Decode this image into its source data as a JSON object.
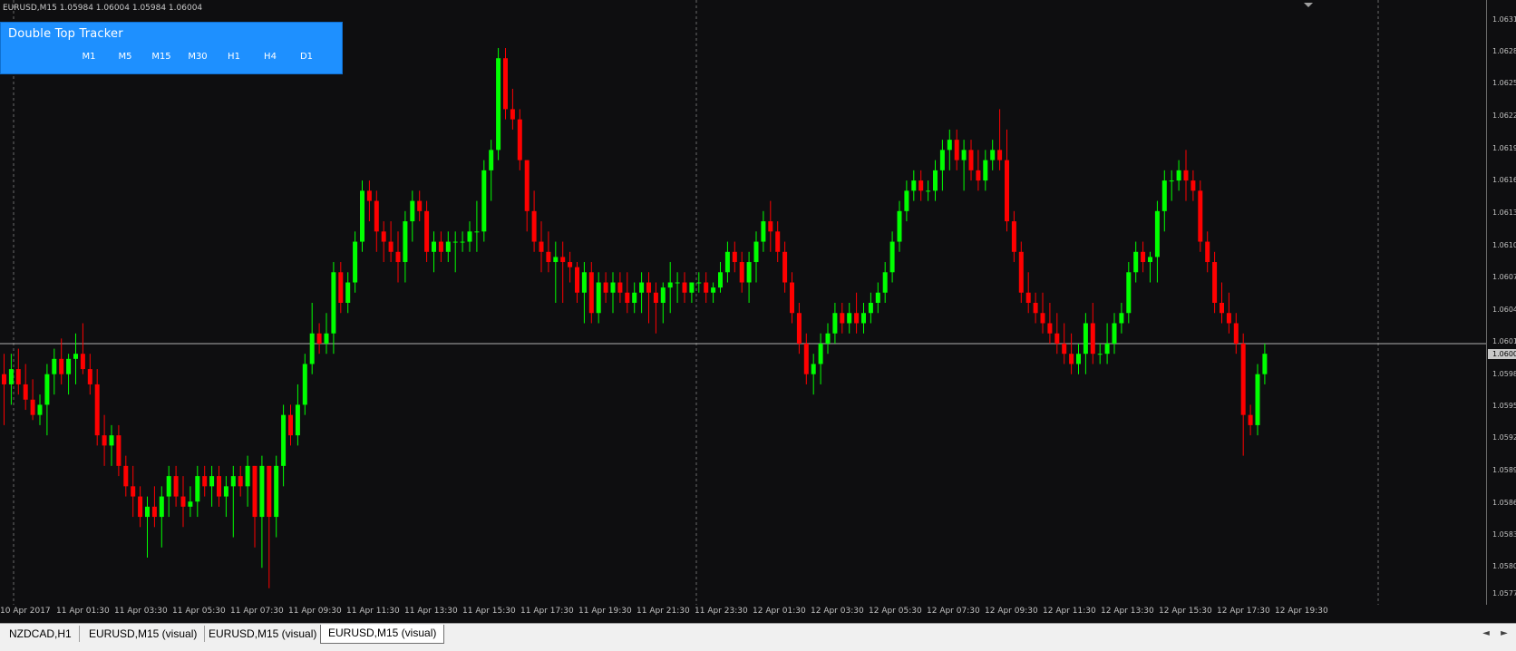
{
  "chart": {
    "symbol_info": "EURUSD,M15  1.05984 1.06004 1.05984 1.06004",
    "current_price": "1.0600",
    "bull_color": "#00ff00",
    "bear_color": "#ff0000",
    "background": "#0e0e10"
  },
  "tracker": {
    "title": "Double Top Tracker",
    "timeframes": [
      "M1",
      "M5",
      "M15",
      "M30",
      "H1",
      "H4",
      "D1"
    ]
  },
  "price_axis": {
    "labels": [
      "1.0631",
      "1.0628",
      "1.0625",
      "1.0622",
      "1.0619",
      "1.0616",
      "1.0613",
      "1.0610",
      "1.0607",
      "1.0604",
      "1.0601",
      "1.0598",
      "1.0595",
      "1.0592",
      "1.0589",
      "1.0586",
      "1.0583",
      "1.0580",
      "1.0577"
    ]
  },
  "time_axis": {
    "labels": [
      "10 Apr 2017",
      "11 Apr 01:30",
      "11 Apr 03:30",
      "11 Apr 05:30",
      "11 Apr 07:30",
      "11 Apr 09:30",
      "11 Apr 11:30",
      "11 Apr 13:30",
      "11 Apr 15:30",
      "11 Apr 17:30",
      "11 Apr 19:30",
      "11 Apr 21:30",
      "11 Apr 23:30",
      "12 Apr 01:30",
      "12 Apr 03:30",
      "12 Apr 05:30",
      "12 Apr 07:30",
      "12 Apr 09:30",
      "12 Apr 11:30",
      "12 Apr 13:30",
      "12 Apr 15:30",
      "12 Apr 17:30",
      "12 Apr 19:30"
    ]
  },
  "tabs": {
    "items": [
      "NZDCAD,H1",
      "EURUSD,M15 (visual)",
      "EURUSD,M15 (visual)",
      "EURUSD,M15 (visual)"
    ],
    "active_index": 3,
    "scroll_left": "◄",
    "scroll_right": "►"
  },
  "chart_data": {
    "type": "candlestick",
    "symbol": "EURUSD",
    "timeframe": "M15",
    "price_range": [
      1.0575,
      1.0633
    ],
    "candles": [
      {
        "o": 1.0597,
        "h": 1.0599,
        "l": 1.0592,
        "c": 1.0596
      },
      {
        "o": 1.0596,
        "h": 1.0599,
        "l": 1.0594,
        "c": 1.05975
      },
      {
        "o": 1.05975,
        "h": 1.05995,
        "l": 1.0595,
        "c": 1.0596
      },
      {
        "o": 1.0596,
        "h": 1.0598,
        "l": 1.05935,
        "c": 1.05945
      },
      {
        "o": 1.05945,
        "h": 1.05965,
        "l": 1.05925,
        "c": 1.0593
      },
      {
        "o": 1.0593,
        "h": 1.0595,
        "l": 1.0592,
        "c": 1.0594
      },
      {
        "o": 1.0594,
        "h": 1.0598,
        "l": 1.0591,
        "c": 1.0597
      },
      {
        "o": 1.0597,
        "h": 1.05995,
        "l": 1.0595,
        "c": 1.05985
      },
      {
        "o": 1.05985,
        "h": 1.06005,
        "l": 1.0596,
        "c": 1.0597
      },
      {
        "o": 1.0597,
        "h": 1.0599,
        "l": 1.0595,
        "c": 1.05985
      },
      {
        "o": 1.05985,
        "h": 1.0601,
        "l": 1.0596,
        "c": 1.0599
      },
      {
        "o": 1.0599,
        "h": 1.0602,
        "l": 1.0597,
        "c": 1.05975
      },
      {
        "o": 1.05975,
        "h": 1.0599,
        "l": 1.0595,
        "c": 1.0596
      },
      {
        "o": 1.0596,
        "h": 1.05975,
        "l": 1.059,
        "c": 1.0591
      },
      {
        "o": 1.0591,
        "h": 1.0593,
        "l": 1.0588,
        "c": 1.059
      },
      {
        "o": 1.059,
        "h": 1.0592,
        "l": 1.0588,
        "c": 1.0591
      },
      {
        "o": 1.0591,
        "h": 1.0592,
        "l": 1.0587,
        "c": 1.0588
      },
      {
        "o": 1.0588,
        "h": 1.0589,
        "l": 1.0585,
        "c": 1.0586
      },
      {
        "o": 1.0586,
        "h": 1.0588,
        "l": 1.0583,
        "c": 1.0585
      },
      {
        "o": 1.0585,
        "h": 1.0586,
        "l": 1.0582,
        "c": 1.0583
      },
      {
        "o": 1.0583,
        "h": 1.0585,
        "l": 1.0579,
        "c": 1.0584
      },
      {
        "o": 1.0584,
        "h": 1.0586,
        "l": 1.0582,
        "c": 1.0583
      },
      {
        "o": 1.0583,
        "h": 1.0586,
        "l": 1.058,
        "c": 1.0585
      },
      {
        "o": 1.0585,
        "h": 1.0588,
        "l": 1.0583,
        "c": 1.0587
      },
      {
        "o": 1.0587,
        "h": 1.0588,
        "l": 1.0584,
        "c": 1.0585
      },
      {
        "o": 1.0585,
        "h": 1.0587,
        "l": 1.0582,
        "c": 1.0584
      },
      {
        "o": 1.0584,
        "h": 1.0586,
        "l": 1.0583,
        "c": 1.05845
      },
      {
        "o": 1.05845,
        "h": 1.0588,
        "l": 1.0583,
        "c": 1.0587
      },
      {
        "o": 1.0587,
        "h": 1.0588,
        "l": 1.0585,
        "c": 1.0586
      },
      {
        "o": 1.0586,
        "h": 1.0588,
        "l": 1.0584,
        "c": 1.0587
      },
      {
        "o": 1.0587,
        "h": 1.0588,
        "l": 1.0584,
        "c": 1.0585
      },
      {
        "o": 1.0585,
        "h": 1.0587,
        "l": 1.0583,
        "c": 1.0586
      },
      {
        "o": 1.0586,
        "h": 1.0588,
        "l": 1.0581,
        "c": 1.0587
      },
      {
        "o": 1.0587,
        "h": 1.0588,
        "l": 1.0585,
        "c": 1.0586
      },
      {
        "o": 1.0586,
        "h": 1.0589,
        "l": 1.0584,
        "c": 1.0588
      },
      {
        "o": 1.0588,
        "h": 1.0588,
        "l": 1.058,
        "c": 1.0583
      },
      {
        "o": 1.0583,
        "h": 1.0589,
        "l": 1.0578,
        "c": 1.0588
      },
      {
        "o": 1.0588,
        "h": 1.0588,
        "l": 1.0576,
        "c": 1.0583
      },
      {
        "o": 1.0583,
        "h": 1.0589,
        "l": 1.0581,
        "c": 1.0588
      },
      {
        "o": 1.0588,
        "h": 1.0594,
        "l": 1.0586,
        "c": 1.0593
      },
      {
        "o": 1.0593,
        "h": 1.0594,
        "l": 1.059,
        "c": 1.0591
      },
      {
        "o": 1.0591,
        "h": 1.0596,
        "l": 1.059,
        "c": 1.0594
      },
      {
        "o": 1.0594,
        "h": 1.0599,
        "l": 1.0593,
        "c": 1.0598
      },
      {
        "o": 1.0598,
        "h": 1.0604,
        "l": 1.0597,
        "c": 1.0601
      },
      {
        "o": 1.0601,
        "h": 1.0602,
        "l": 1.0599,
        "c": 1.06
      },
      {
        "o": 1.06,
        "h": 1.0603,
        "l": 1.0599,
        "c": 1.0601
      },
      {
        "o": 1.0601,
        "h": 1.0608,
        "l": 1.0599,
        "c": 1.0607
      },
      {
        "o": 1.0607,
        "h": 1.0608,
        "l": 1.0603,
        "c": 1.0604
      },
      {
        "o": 1.0604,
        "h": 1.0607,
        "l": 1.0603,
        "c": 1.0606
      },
      {
        "o": 1.0606,
        "h": 1.0611,
        "l": 1.0605,
        "c": 1.061
      },
      {
        "o": 1.061,
        "h": 1.0616,
        "l": 1.0609,
        "c": 1.0615
      },
      {
        "o": 1.0615,
        "h": 1.0616,
        "l": 1.0612,
        "c": 1.0614
      },
      {
        "o": 1.0614,
        "h": 1.0615,
        "l": 1.0609,
        "c": 1.0611
      },
      {
        "o": 1.0611,
        "h": 1.0612,
        "l": 1.0608,
        "c": 1.061
      },
      {
        "o": 1.061,
        "h": 1.0612,
        "l": 1.0608,
        "c": 1.0609
      },
      {
        "o": 1.0609,
        "h": 1.0611,
        "l": 1.0606,
        "c": 1.0608
      },
      {
        "o": 1.0608,
        "h": 1.0613,
        "l": 1.0606,
        "c": 1.0612
      },
      {
        "o": 1.0612,
        "h": 1.0615,
        "l": 1.061,
        "c": 1.0614
      },
      {
        "o": 1.0614,
        "h": 1.0615,
        "l": 1.0612,
        "c": 1.0613
      },
      {
        "o": 1.0613,
        "h": 1.0614,
        "l": 1.0608,
        "c": 1.0609
      },
      {
        "o": 1.0609,
        "h": 1.0611,
        "l": 1.0607,
        "c": 1.061
      },
      {
        "o": 1.061,
        "h": 1.0611,
        "l": 1.0608,
        "c": 1.0609
      },
      {
        "o": 1.0609,
        "h": 1.0611,
        "l": 1.0608,
        "c": 1.061
      },
      {
        "o": 1.061,
        "h": 1.0611,
        "l": 1.0607,
        "c": 1.061
      },
      {
        "o": 1.061,
        "h": 1.0611,
        "l": 1.0609,
        "c": 1.061
      },
      {
        "o": 1.061,
        "h": 1.0612,
        "l": 1.0609,
        "c": 1.0611
      },
      {
        "o": 1.0611,
        "h": 1.0614,
        "l": 1.0609,
        "c": 1.0611
      },
      {
        "o": 1.0611,
        "h": 1.0618,
        "l": 1.061,
        "c": 1.0617
      },
      {
        "o": 1.0617,
        "h": 1.062,
        "l": 1.0614,
        "c": 1.0619
      },
      {
        "o": 1.0619,
        "h": 1.0629,
        "l": 1.0618,
        "c": 1.0628
      },
      {
        "o": 1.0628,
        "h": 1.0629,
        "l": 1.0622,
        "c": 1.0623
      },
      {
        "o": 1.0623,
        "h": 1.0625,
        "l": 1.0621,
        "c": 1.0622
      },
      {
        "o": 1.0622,
        "h": 1.0623,
        "l": 1.0617,
        "c": 1.0618
      },
      {
        "o": 1.0618,
        "h": 1.0618,
        "l": 1.0611,
        "c": 1.0613
      },
      {
        "o": 1.0613,
        "h": 1.0615,
        "l": 1.0609,
        "c": 1.061
      },
      {
        "o": 1.061,
        "h": 1.0612,
        "l": 1.0607,
        "c": 1.0609
      },
      {
        "o": 1.0609,
        "h": 1.0611,
        "l": 1.0607,
        "c": 1.0608
      },
      {
        "o": 1.0608,
        "h": 1.061,
        "l": 1.0604,
        "c": 1.06085
      },
      {
        "o": 1.06085,
        "h": 1.061,
        "l": 1.0604,
        "c": 1.0608
      },
      {
        "o": 1.0608,
        "h": 1.0609,
        "l": 1.0606,
        "c": 1.06075
      },
      {
        "o": 1.06075,
        "h": 1.0608,
        "l": 1.0604,
        "c": 1.0605
      },
      {
        "o": 1.0605,
        "h": 1.0608,
        "l": 1.0602,
        "c": 1.0607
      },
      {
        "o": 1.0607,
        "h": 1.0608,
        "l": 1.0602,
        "c": 1.0603
      },
      {
        "o": 1.0603,
        "h": 1.0607,
        "l": 1.0602,
        "c": 1.0606
      },
      {
        "o": 1.0606,
        "h": 1.0607,
        "l": 1.0604,
        "c": 1.0605
      },
      {
        "o": 1.0605,
        "h": 1.0607,
        "l": 1.0603,
        "c": 1.0606
      },
      {
        "o": 1.0606,
        "h": 1.0607,
        "l": 1.0604,
        "c": 1.0605
      },
      {
        "o": 1.0605,
        "h": 1.0607,
        "l": 1.0603,
        "c": 1.0604
      },
      {
        "o": 1.0604,
        "h": 1.0606,
        "l": 1.0603,
        "c": 1.0605
      },
      {
        "o": 1.0605,
        "h": 1.0607,
        "l": 1.0603,
        "c": 1.0606
      },
      {
        "o": 1.0606,
        "h": 1.0607,
        "l": 1.0602,
        "c": 1.0605
      },
      {
        "o": 1.0605,
        "h": 1.0606,
        "l": 1.0601,
        "c": 1.0604
      },
      {
        "o": 1.0604,
        "h": 1.0606,
        "l": 1.0602,
        "c": 1.06055
      },
      {
        "o": 1.06055,
        "h": 1.0608,
        "l": 1.0603,
        "c": 1.0606
      },
      {
        "o": 1.0606,
        "h": 1.0607,
        "l": 1.0604,
        "c": 1.0606
      },
      {
        "o": 1.0606,
        "h": 1.0607,
        "l": 1.0604,
        "c": 1.0605
      },
      {
        "o": 1.0605,
        "h": 1.0606,
        "l": 1.0604,
        "c": 1.0606
      },
      {
        "o": 1.0606,
        "h": 1.0607,
        "l": 1.0605,
        "c": 1.0606
      },
      {
        "o": 1.0606,
        "h": 1.0607,
        "l": 1.0604,
        "c": 1.0605
      },
      {
        "o": 1.0605,
        "h": 1.0606,
        "l": 1.0604,
        "c": 1.06055
      },
      {
        "o": 1.06055,
        "h": 1.0608,
        "l": 1.0605,
        "c": 1.0607
      },
      {
        "o": 1.0607,
        "h": 1.061,
        "l": 1.0606,
        "c": 1.0609
      },
      {
        "o": 1.0609,
        "h": 1.061,
        "l": 1.0607,
        "c": 1.0608
      },
      {
        "o": 1.0608,
        "h": 1.0609,
        "l": 1.0605,
        "c": 1.0606
      },
      {
        "o": 1.0606,
        "h": 1.0609,
        "l": 1.0604,
        "c": 1.0608
      },
      {
        "o": 1.0608,
        "h": 1.0611,
        "l": 1.0606,
        "c": 1.061
      },
      {
        "o": 1.061,
        "h": 1.0613,
        "l": 1.0609,
        "c": 1.0612
      },
      {
        "o": 1.0612,
        "h": 1.0614,
        "l": 1.0609,
        "c": 1.0611
      },
      {
        "o": 1.0611,
        "h": 1.0612,
        "l": 1.0608,
        "c": 1.0609
      },
      {
        "o": 1.0609,
        "h": 1.061,
        "l": 1.0605,
        "c": 1.0606
      },
      {
        "o": 1.0606,
        "h": 1.0607,
        "l": 1.0602,
        "c": 1.0603
      },
      {
        "o": 1.0603,
        "h": 1.0604,
        "l": 1.0599,
        "c": 1.06
      },
      {
        "o": 1.06,
        "h": 1.0601,
        "l": 1.0596,
        "c": 1.0597
      },
      {
        "o": 1.0597,
        "h": 1.0599,
        "l": 1.0595,
        "c": 1.0598
      },
      {
        "o": 1.0598,
        "h": 1.0601,
        "l": 1.0596,
        "c": 1.06
      },
      {
        "o": 1.06,
        "h": 1.0602,
        "l": 1.0599,
        "c": 1.0601
      },
      {
        "o": 1.0601,
        "h": 1.0604,
        "l": 1.06,
        "c": 1.0603
      },
      {
        "o": 1.0603,
        "h": 1.0604,
        "l": 1.0601,
        "c": 1.0602
      },
      {
        "o": 1.0602,
        "h": 1.0604,
        "l": 1.0601,
        "c": 1.0603
      },
      {
        "o": 1.0603,
        "h": 1.0605,
        "l": 1.0601,
        "c": 1.0602
      },
      {
        "o": 1.0602,
        "h": 1.0604,
        "l": 1.0601,
        "c": 1.0603
      },
      {
        "o": 1.0603,
        "h": 1.0605,
        "l": 1.0602,
        "c": 1.0604
      },
      {
        "o": 1.0604,
        "h": 1.0606,
        "l": 1.0603,
        "c": 1.0605
      },
      {
        "o": 1.0605,
        "h": 1.0608,
        "l": 1.0604,
        "c": 1.0607
      },
      {
        "o": 1.0607,
        "h": 1.0611,
        "l": 1.0606,
        "c": 1.061
      },
      {
        "o": 1.061,
        "h": 1.0614,
        "l": 1.0609,
        "c": 1.0613
      },
      {
        "o": 1.0613,
        "h": 1.0616,
        "l": 1.0612,
        "c": 1.0615
      },
      {
        "o": 1.0615,
        "h": 1.0617,
        "l": 1.0614,
        "c": 1.0616
      },
      {
        "o": 1.0616,
        "h": 1.0617,
        "l": 1.0614,
        "c": 1.0615
      },
      {
        "o": 1.0615,
        "h": 1.0616,
        "l": 1.0614,
        "c": 1.0615
      },
      {
        "o": 1.0615,
        "h": 1.0618,
        "l": 1.0614,
        "c": 1.0617
      },
      {
        "o": 1.0617,
        "h": 1.062,
        "l": 1.0615,
        "c": 1.0619
      },
      {
        "o": 1.0619,
        "h": 1.0621,
        "l": 1.0617,
        "c": 1.062
      },
      {
        "o": 1.062,
        "h": 1.0621,
        "l": 1.0617,
        "c": 1.0618
      },
      {
        "o": 1.0618,
        "h": 1.062,
        "l": 1.0615,
        "c": 1.0619
      },
      {
        "o": 1.0619,
        "h": 1.062,
        "l": 1.0616,
        "c": 1.0617
      },
      {
        "o": 1.0617,
        "h": 1.0619,
        "l": 1.0615,
        "c": 1.0616
      },
      {
        "o": 1.0616,
        "h": 1.0619,
        "l": 1.0615,
        "c": 1.0618
      },
      {
        "o": 1.0618,
        "h": 1.062,
        "l": 1.0617,
        "c": 1.0619
      },
      {
        "o": 1.0619,
        "h": 1.0623,
        "l": 1.0617,
        "c": 1.0618
      },
      {
        "o": 1.0618,
        "h": 1.0621,
        "l": 1.0611,
        "c": 1.0612
      },
      {
        "o": 1.0612,
        "h": 1.0613,
        "l": 1.0608,
        "c": 1.0609
      },
      {
        "o": 1.0609,
        "h": 1.061,
        "l": 1.0604,
        "c": 1.0605
      },
      {
        "o": 1.0605,
        "h": 1.0607,
        "l": 1.0603,
        "c": 1.0604
      },
      {
        "o": 1.0604,
        "h": 1.0605,
        "l": 1.0602,
        "c": 1.0603
      },
      {
        "o": 1.0603,
        "h": 1.0605,
        "l": 1.0601,
        "c": 1.0602
      },
      {
        "o": 1.0602,
        "h": 1.0604,
        "l": 1.06,
        "c": 1.0601
      },
      {
        "o": 1.0601,
        "h": 1.0603,
        "l": 1.0599,
        "c": 1.06
      },
      {
        "o": 1.06,
        "h": 1.0602,
        "l": 1.0598,
        "c": 1.0599
      },
      {
        "o": 1.0599,
        "h": 1.0601,
        "l": 1.0597,
        "c": 1.0598
      },
      {
        "o": 1.0598,
        "h": 1.06,
        "l": 1.0597,
        "c": 1.0599
      },
      {
        "o": 1.0599,
        "h": 1.0603,
        "l": 1.0597,
        "c": 1.0602
      },
      {
        "o": 1.0602,
        "h": 1.0604,
        "l": 1.0598,
        "c": 1.0599
      },
      {
        "o": 1.0599,
        "h": 1.06,
        "l": 1.0598,
        "c": 1.0599
      },
      {
        "o": 1.0599,
        "h": 1.0602,
        "l": 1.0598,
        "c": 1.06
      },
      {
        "o": 1.06,
        "h": 1.0603,
        "l": 1.0599,
        "c": 1.0602
      },
      {
        "o": 1.0602,
        "h": 1.0604,
        "l": 1.0601,
        "c": 1.0603
      },
      {
        "o": 1.0603,
        "h": 1.0608,
        "l": 1.0602,
        "c": 1.0607
      },
      {
        "o": 1.0607,
        "h": 1.061,
        "l": 1.0606,
        "c": 1.0609
      },
      {
        "o": 1.0609,
        "h": 1.061,
        "l": 1.0607,
        "c": 1.0608
      },
      {
        "o": 1.0608,
        "h": 1.0609,
        "l": 1.0606,
        "c": 1.06085
      },
      {
        "o": 1.06085,
        "h": 1.0614,
        "l": 1.0606,
        "c": 1.0613
      },
      {
        "o": 1.0613,
        "h": 1.0617,
        "l": 1.0611,
        "c": 1.0616
      },
      {
        "o": 1.0616,
        "h": 1.0617,
        "l": 1.0614,
        "c": 1.0616
      },
      {
        "o": 1.0616,
        "h": 1.0618,
        "l": 1.0615,
        "c": 1.0617
      },
      {
        "o": 1.0617,
        "h": 1.0619,
        "l": 1.0614,
        "c": 1.0616
      },
      {
        "o": 1.0616,
        "h": 1.0617,
        "l": 1.0614,
        "c": 1.0615
      },
      {
        "o": 1.0615,
        "h": 1.0616,
        "l": 1.0609,
        "c": 1.061
      },
      {
        "o": 1.061,
        "h": 1.0611,
        "l": 1.0607,
        "c": 1.0608
      },
      {
        "o": 1.0608,
        "h": 1.0609,
        "l": 1.0603,
        "c": 1.0604
      },
      {
        "o": 1.0604,
        "h": 1.0606,
        "l": 1.0602,
        "c": 1.0603
      },
      {
        "o": 1.0603,
        "h": 1.0605,
        "l": 1.0601,
        "c": 1.0602
      },
      {
        "o": 1.0602,
        "h": 1.0603,
        "l": 1.0599,
        "c": 1.06
      },
      {
        "o": 1.06,
        "h": 1.0601,
        "l": 1.0589,
        "c": 1.0593
      },
      {
        "o": 1.0593,
        "h": 1.0594,
        "l": 1.0591,
        "c": 1.0592
      },
      {
        "o": 1.0592,
        "h": 1.0598,
        "l": 1.0591,
        "c": 1.0597
      },
      {
        "o": 1.0597,
        "h": 1.06,
        "l": 1.0596,
        "c": 1.0599
      }
    ]
  }
}
